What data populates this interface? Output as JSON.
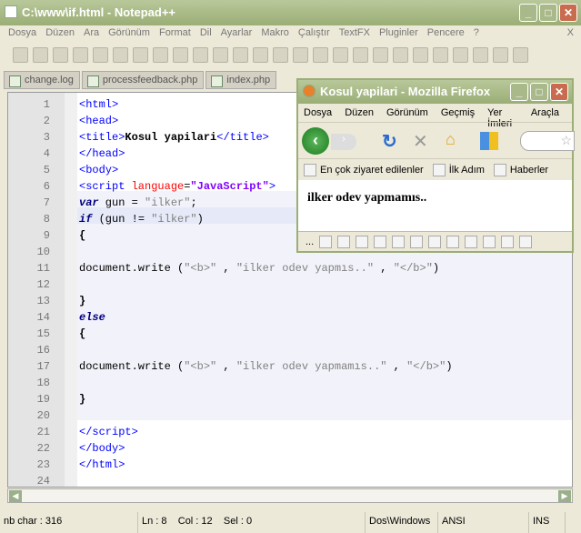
{
  "window": {
    "title": "C:\\www\\if.html - Notepad++"
  },
  "menu": [
    "Dosya",
    "Düzen",
    "Ara",
    "Görünüm",
    "Format",
    "Dil",
    "Ayarlar",
    "Makro",
    "Çalıştır",
    "TextFX",
    "Pluginler",
    "Pencere",
    "?"
  ],
  "menu_close": "X",
  "tabs": [
    "change.log",
    "processfeedback.php",
    "index.php"
  ],
  "code": [
    [
      [
        "<html>",
        "tag"
      ]
    ],
    [
      [
        "<head>",
        "tag"
      ]
    ],
    [
      [
        "<title>",
        "tag"
      ],
      [
        "Kosul yapilari",
        "bold"
      ],
      [
        "</title>",
        "tag"
      ]
    ],
    [
      [
        "</head>",
        "tag"
      ]
    ],
    [
      [
        "<body>",
        "tag"
      ]
    ],
    [
      [
        "<script ",
        "tag"
      ],
      [
        "language",
        "attr"
      ],
      [
        "=",
        "txt"
      ],
      [
        "\"JavaScript\"",
        "val"
      ],
      [
        ">",
        "tag"
      ]
    ],
    [
      [
        "var",
        "kw"
      ],
      [
        " gun = ",
        "txt"
      ],
      [
        "\"ilker\"",
        "str"
      ],
      [
        ";",
        "txt"
      ]
    ],
    [
      [
        "if",
        "kw"
      ],
      [
        " (gun != ",
        "txt"
      ],
      [
        "\"ilker\"",
        "str"
      ],
      [
        ")",
        "txt"
      ]
    ],
    [
      [
        "{",
        "bold"
      ]
    ],
    [],
    [
      [
        "document.write (",
        "txt"
      ],
      [
        "\"<b>\"",
        "str"
      ],
      [
        " , ",
        "txt"
      ],
      [
        "\"ilker odev yapmıs..\"",
        "str"
      ],
      [
        " , ",
        "txt"
      ],
      [
        "\"</b>\"",
        "str"
      ],
      [
        ")",
        "txt"
      ]
    ],
    [],
    [
      [
        "}",
        "bold"
      ]
    ],
    [
      [
        "else",
        "kw"
      ]
    ],
    [
      [
        "{",
        "bold"
      ]
    ],
    [],
    [
      [
        "document.write (",
        "txt"
      ],
      [
        "\"<b>\"",
        "str"
      ],
      [
        " , ",
        "txt"
      ],
      [
        "\"ilker odev yapmamıs..\"",
        "str"
      ],
      [
        " , ",
        "txt"
      ],
      [
        "\"</b>\"",
        "str"
      ],
      [
        ")",
        "txt"
      ]
    ],
    [],
    [
      [
        "}",
        "bold"
      ]
    ],
    [],
    [
      [
        "</script>",
        "tag"
      ]
    ],
    [
      [
        "</body>",
        "tag"
      ]
    ],
    [
      [
        "</html>",
        "tag"
      ]
    ],
    []
  ],
  "status": {
    "chars": "nb char : 316",
    "pos": "Ln : 8    Col : 12    Sel : 0",
    "eol": "Dos\\Windows",
    "enc": "ANSI",
    "mode": "INS"
  },
  "firefox": {
    "title": "Kosul yapilari - Mozilla Firefox",
    "menu": [
      "Dosya",
      "Düzen",
      "Görünüm",
      "Geçmiş",
      "Yer İmleri",
      "Araçla"
    ],
    "bookmarks": [
      "En çok ziyaret edilenler",
      "İlk Adım",
      "Haberler"
    ],
    "content": "ilker odev yapmamıs..",
    "status_dots": "..."
  }
}
